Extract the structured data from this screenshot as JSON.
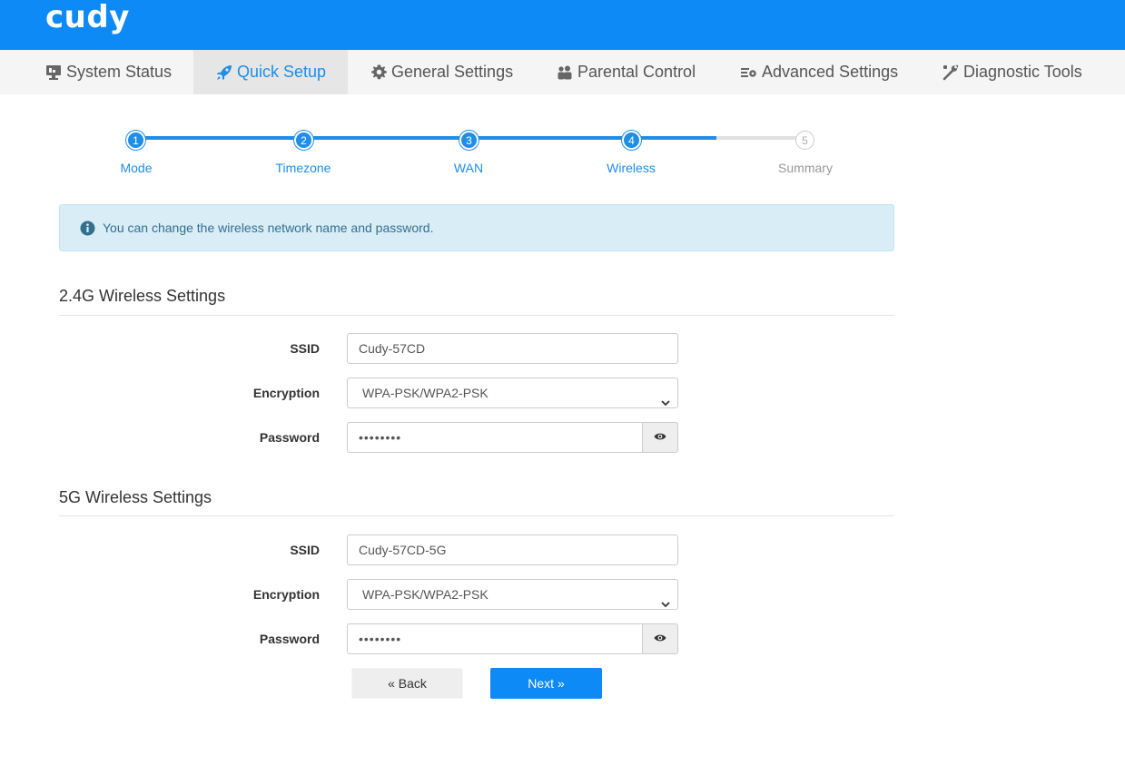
{
  "brand": {
    "logo_text": "cudy",
    "primary_color": "#0d8af5",
    "accent_color": "#1e8ee8"
  },
  "nav": {
    "items": [
      {
        "label": "System Status",
        "icon": "monitor-icon",
        "active": false
      },
      {
        "label": "Quick Setup",
        "icon": "rocket-icon",
        "active": true
      },
      {
        "label": "General Settings",
        "icon": "gear-icon",
        "active": false
      },
      {
        "label": "Parental Control",
        "icon": "users-icon",
        "active": false
      },
      {
        "label": "Advanced Settings",
        "icon": "sliders-gear-icon",
        "active": false
      },
      {
        "label": "Diagnostic Tools",
        "icon": "wrench-icon",
        "active": false
      }
    ]
  },
  "stepper": {
    "current_step": 4,
    "steps": [
      {
        "number": "1",
        "label": "Mode",
        "state": "done"
      },
      {
        "number": "2",
        "label": "Timezone",
        "state": "done"
      },
      {
        "number": "3",
        "label": "WAN",
        "state": "done"
      },
      {
        "number": "4",
        "label": "Wireless",
        "state": "current"
      },
      {
        "number": "5",
        "label": "Summary",
        "state": "todo"
      }
    ]
  },
  "info": {
    "text": "You can change the wireless network name and password.",
    "icon": "info-circle-icon"
  },
  "band24": {
    "title": "2.4G Wireless Settings",
    "ssid_label": "SSID",
    "ssid_value": "Cudy-57CD",
    "encryption_label": "Encryption",
    "encryption_value": "WPA-PSK/WPA2-PSK",
    "password_label": "Password",
    "password_value": "••••••••"
  },
  "band5": {
    "title": "5G Wireless Settings",
    "ssid_label": "SSID",
    "ssid_value": "Cudy-57CD-5G",
    "encryption_label": "Encryption",
    "encryption_value": "WPA-PSK/WPA2-PSK",
    "password_label": "Password",
    "password_value": "••••••••"
  },
  "actions": {
    "back_label": "« Back",
    "next_label": "Next »"
  }
}
